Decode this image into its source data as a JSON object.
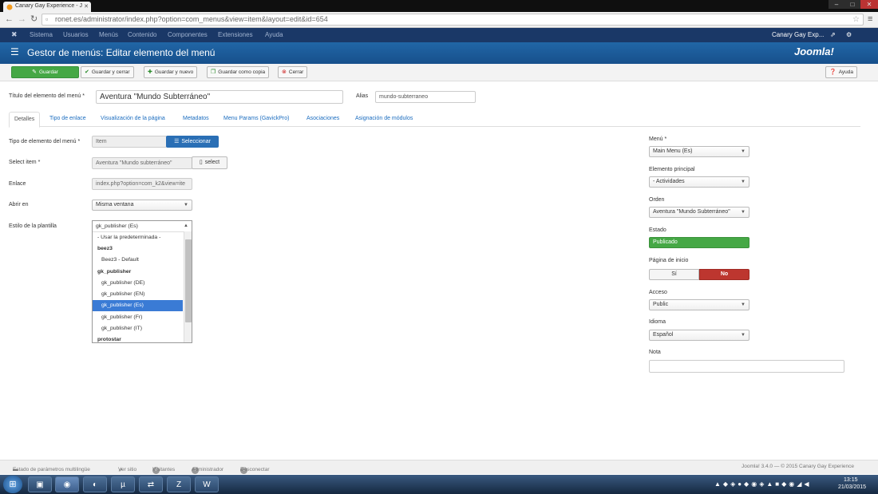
{
  "browser": {
    "tab_title": "Canary Gay Experience - J",
    "url": "ronet.es/administrator/index.php?option=com_menus&view=item&layout=edit&id=654"
  },
  "topmenu": {
    "items": [
      "Sistema",
      "Usuarios",
      "Menús",
      "Contenido",
      "Componentes",
      "Extensiones",
      "Ayuda"
    ],
    "site": "Canary Gay Exp..."
  },
  "header": {
    "title": "Gestor de menús: Editar elemento del menú",
    "brand": "Joomla!"
  },
  "toolbar": {
    "save": "Guardar",
    "save_close": "Guardar y cerrar",
    "save_new": "Guardar y nuevo",
    "save_copy": "Guardar como copia",
    "close": "Cerrar",
    "help": "Ayuda"
  },
  "form": {
    "title_label": "Título del elemento del menú *",
    "title_value": "Aventura \"Mundo Subterráneo\"",
    "alias_label": "Alias",
    "alias_value": "mundo-subterraneo",
    "tabs": [
      "Detalles",
      "Tipo de enlace",
      "Visualización de la página",
      "Metadatos",
      "Menu Params (GavickPro)",
      "Asociaciones",
      "Asignación de módulos"
    ],
    "type_label": "Tipo de elemento del menú *",
    "type_value": "Item",
    "select_btn": "Seleccionar",
    "select_item_label": "Select item *",
    "select_item_value": "Aventura \"Mundo subterráneo\"",
    "select_small": "select",
    "link_label": "Enlace",
    "link_value": "index.php?option=com_k2&view=ite",
    "open_label": "Abrir en",
    "open_value": "Misma ventana",
    "style_label": "Estilo de la plantilla",
    "style_value": "gk_publisher (Es)",
    "style_options": [
      {
        "text": "- Usar la predeterminada -",
        "type": "opt"
      },
      {
        "text": "beez3",
        "type": "grp"
      },
      {
        "text": "Beez3 - Default",
        "type": "opt"
      },
      {
        "text": "gk_publisher",
        "type": "grp"
      },
      {
        "text": "gk_publisher (DE)",
        "type": "opt"
      },
      {
        "text": "gk_publisher (EN)",
        "type": "opt"
      },
      {
        "text": "gk_publisher (Es)",
        "type": "selected"
      },
      {
        "text": "gk_publisher (Fr)",
        "type": "opt"
      },
      {
        "text": "gk_publisher (IT)",
        "type": "opt"
      },
      {
        "text": "protostar",
        "type": "grp"
      }
    ]
  },
  "side": {
    "menu_label": "Menú *",
    "menu_value": "Main Menu (Es)",
    "parent_label": "Elemento principal",
    "parent_value": "- Actividades",
    "order_label": "Orden",
    "order_value": "Aventura \"Mundo Subterráneo\"",
    "status_label": "Estado",
    "status_value": "Publicado",
    "home_label": "Página de inicio",
    "home_yes": "Sí",
    "home_no": "No",
    "access_label": "Acceso",
    "access_value": "Public",
    "lang_label": "Idioma",
    "lang_value": "Español",
    "note_label": "Nota",
    "note_value": ""
  },
  "footer": {
    "multilang": "Estado de parámetros multilingüe",
    "view_site": "Ver sitio",
    "visitors_count": "0",
    "visitors": "Visitantes",
    "admin_count": "1",
    "admin": "Administrador",
    "logout_count": "0",
    "logout": "Desconectar",
    "copyright": "Joomla! 3.4.0 — © 2015 Canary Gay Experience"
  },
  "clock": {
    "time": "13:15",
    "date": "21/03/2015"
  },
  "colors": {
    "header": "#1c5b9b",
    "topbar": "#1a3867",
    "green": "#45a845",
    "red": "#bd362f",
    "link": "#1a6cbf"
  }
}
